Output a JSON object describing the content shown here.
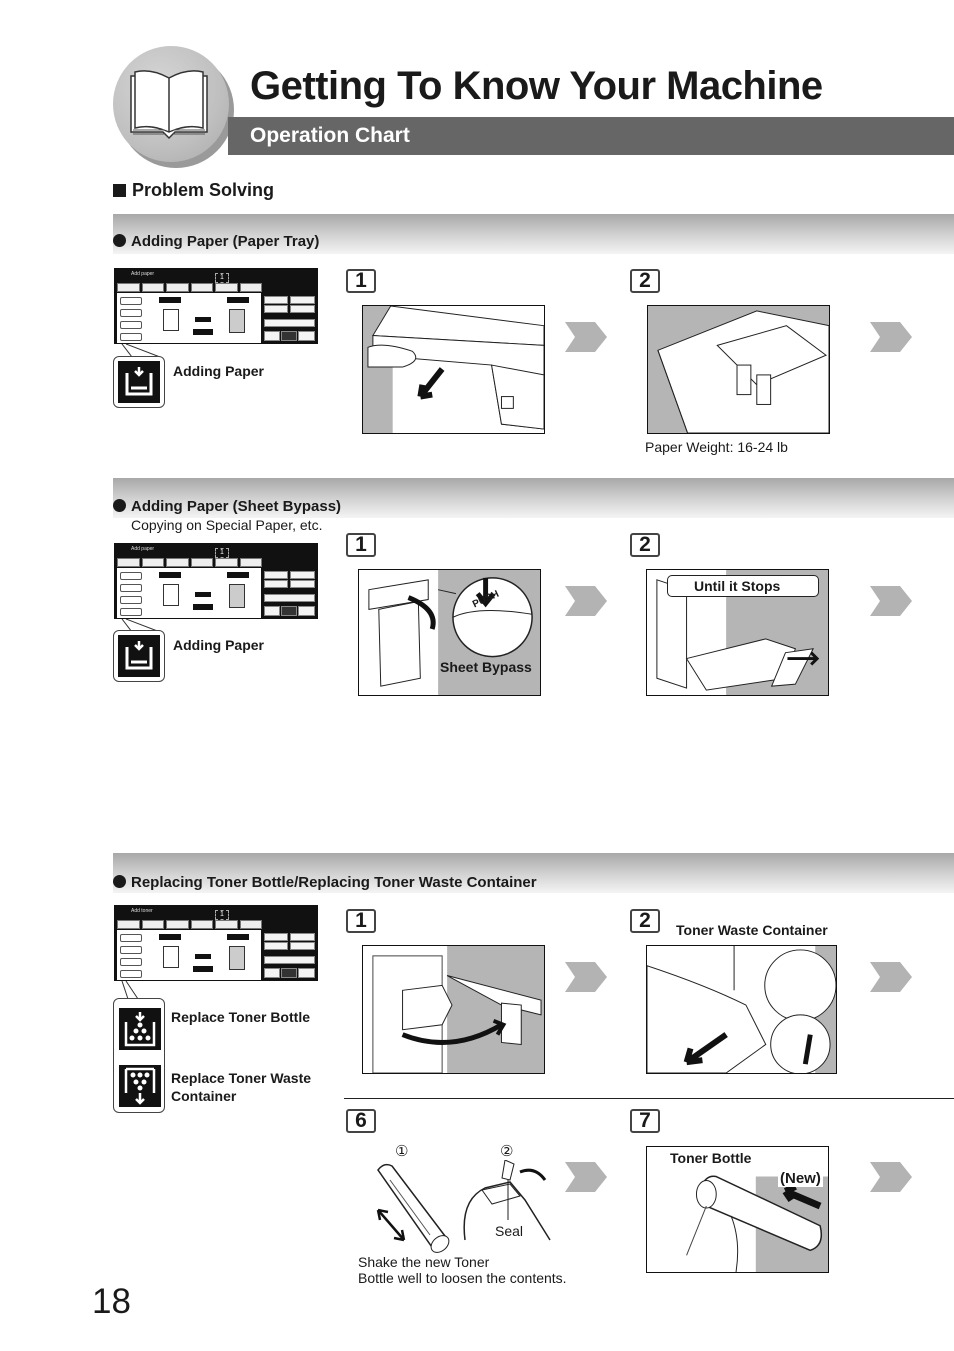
{
  "header": {
    "title": "Getting To Know Your Machine",
    "subtitle": "Operation Chart",
    "icon": "open-book-icon"
  },
  "section": {
    "heading": "Problem Solving"
  },
  "procedures": [
    {
      "heading": "Adding Paper (Paper Tray)",
      "note": "",
      "panel_title": "Add paper",
      "panel_icons": [
        {
          "icon": "add-paper-icon",
          "label": "Adding Paper"
        }
      ],
      "steps": [
        {
          "number": "1",
          "labels": [],
          "caption": ""
        },
        {
          "number": "2",
          "labels": [],
          "caption": "Paper Weight: 16-24 lb"
        }
      ]
    },
    {
      "heading": "Adding Paper (Sheet Bypass)",
      "note": "Copying on Special Paper, etc.",
      "panel_title": "Add paper",
      "panel_icons": [
        {
          "icon": "add-paper-icon",
          "label": "Adding Paper"
        }
      ],
      "steps": [
        {
          "number": "1",
          "labels": [
            "Sheet Bypass",
            "PUSH"
          ],
          "caption": ""
        },
        {
          "number": "2",
          "labels": [
            "Until it Stops"
          ],
          "caption": ""
        }
      ]
    },
    {
      "heading": "Replacing Toner Bottle/Replacing Toner Waste Container",
      "note": "",
      "panel_title": "Add toner",
      "panel_icons": [
        {
          "icon": "replace-toner-bottle-icon",
          "label": "Replace Toner Bottle"
        },
        {
          "icon": "replace-toner-waste-icon",
          "label": "Replace Toner Waste Container",
          "label_line1": "Replace Toner Waste",
          "label_line2": "Container"
        }
      ],
      "steps": [
        {
          "number": "1",
          "labels": [],
          "caption": ""
        },
        {
          "number": "2",
          "labels": [
            "Toner Waste Container"
          ],
          "caption": ""
        },
        {
          "number": "6",
          "labels": [
            "①",
            "②",
            "Seal"
          ],
          "caption_line1": "Shake the new Toner",
          "caption_line2": "Bottle well to loosen the contents."
        },
        {
          "number": "7",
          "labels": [
            "Toner Bottle",
            "(New)"
          ],
          "caption": ""
        }
      ]
    }
  ],
  "panel_ui": {
    "count": "1",
    "paper_size": "LETTER",
    "zoom": "100%",
    "lighter": "LIGHTER",
    "darker": "DARKER"
  },
  "page_number": "18",
  "colors": {
    "title_bar": "#666666",
    "band_dark": "#a8a8a8",
    "chevron": "#b3b3b3",
    "illus_gray": "#b5b5b5"
  }
}
